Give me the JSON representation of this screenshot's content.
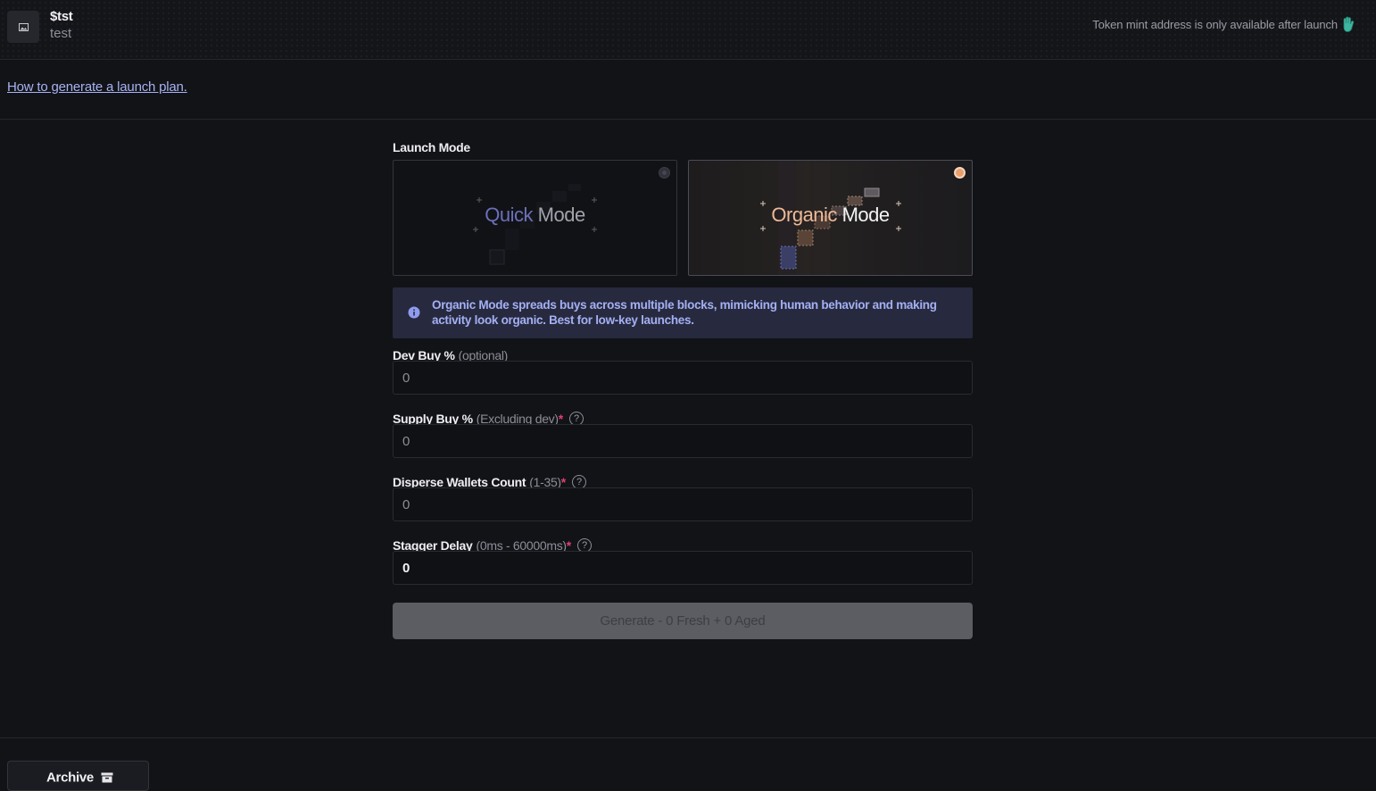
{
  "header": {
    "token_symbol": "$tst",
    "token_name": "test",
    "mint_note": "Token mint address is only available after launch",
    "mint_icon": "hand-wave-icon"
  },
  "howto": {
    "link_text": "How to generate a launch plan."
  },
  "launch_mode": {
    "label": "Launch Mode",
    "options": [
      {
        "word1": "Quick",
        "word2": "Mode",
        "selected": false
      },
      {
        "word1": "Organic",
        "word2": "Mode",
        "selected": true
      }
    ],
    "info_text": "Organic Mode spreads buys across multiple blocks, mimicking human behavior and making activity look organic. Best for low-key launches."
  },
  "fields": [
    {
      "label": "Dev Buy %",
      "hint": "(optional)",
      "required": "",
      "value": "0",
      "has_help": false
    },
    {
      "label": "Supply Buy %",
      "hint": "(Excluding dev)",
      "required": "*",
      "value": "0",
      "has_help": true
    },
    {
      "label": "Disperse Wallets Count",
      "hint": "(1-35)",
      "required": "*",
      "value": "0",
      "has_help": true
    },
    {
      "label": "Stagger Delay",
      "hint": "(0ms - 60000ms)",
      "required": "*",
      "value": "0",
      "has_help": true
    }
  ],
  "help_glyph": "?",
  "generate_button": {
    "label": "Generate - 0 Fresh + 0 Aged",
    "enabled": false
  },
  "archive_button": {
    "label": "Archive",
    "icon": "archive-box-icon"
  },
  "colors": {
    "background": "#121317",
    "accent_link": "#a6b2f2",
    "organic_accent": "#e9a06b",
    "required_marker": "#e0406e",
    "info_background": "#272a3e"
  }
}
